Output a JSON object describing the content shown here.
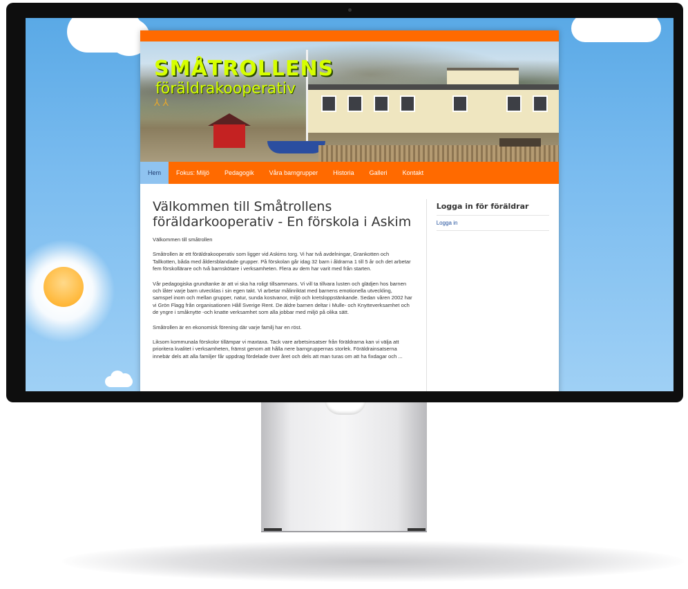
{
  "site": {
    "logo_title": "SMÅTROLLENS",
    "logo_subtitle": "föräldrakooperativ",
    "logo_feet": "⅄ ⅄"
  },
  "nav": {
    "items": [
      {
        "label": "Hem",
        "active": true
      },
      {
        "label": "Fokus: Miljö"
      },
      {
        "label": "Pedagogik"
      },
      {
        "label": "Våra barngrupper"
      },
      {
        "label": "Historia"
      },
      {
        "label": "Galleri"
      },
      {
        "label": "Kontakt"
      }
    ]
  },
  "main": {
    "title": "Välkommen till Småtrollens föräldarkooperativ - En förskola i Askim",
    "paragraphs": [
      "Välkommen till småtrollen",
      "Småtrollen är ett föräldrakooperativ som ligger vid Askims torg. Vi har två avdelningar, Grankotten och Tallkotten, båda med åldersblandade grupper. På förskolan går idag 32 barn i åldrarna 1 till 5 år och det arbetar fem förskollärare och två barnskötare i verksamheten. Flera av dem har varit med från starten.",
      "Vår pedagogiska grundtanke är att vi ska ha roligt tillsammans. Vi vill ta tillvara lusten och glädjen hos barnen och låter varje barn utvecklas i sin egen takt. Vi arbetar målinriktat med barnens emotionella utveckling, samspel inom och mellan grupper, natur, sunda kostvanor, miljö och kretsloppstänkande. Sedan våren 2002 har vi Grön Flagg från organisationen Håll Sverige Rent. De äldre barnen deltar i Mulle- och Knytteverksamhet och de yngre i småknytte -och knatte verksamhet som alla jobbar med miljö på olika sätt.",
      "Småtrollen är en ekonomisk förening där varje familj har en röst.",
      "Liksom kommunala förskolor tillämpar vi maxtaxa. Tack vare arbetsinsatser från föräldrarna kan vi välja att prioritera kvalitet i verksamheten, främst genom att hålla nere barngruppernas storlek. Föräldrainsatserna innebär dels att alla familjer får uppdrag fördelade över året och dels att man turas om att ha fixdagar och ..."
    ]
  },
  "sidebar": {
    "title": "Logga in för föräldrar",
    "link": "Logga in"
  },
  "colors": {
    "accent": "#ff6a00",
    "nav_active": "#8fc3f0",
    "link": "#1f4e9c"
  }
}
